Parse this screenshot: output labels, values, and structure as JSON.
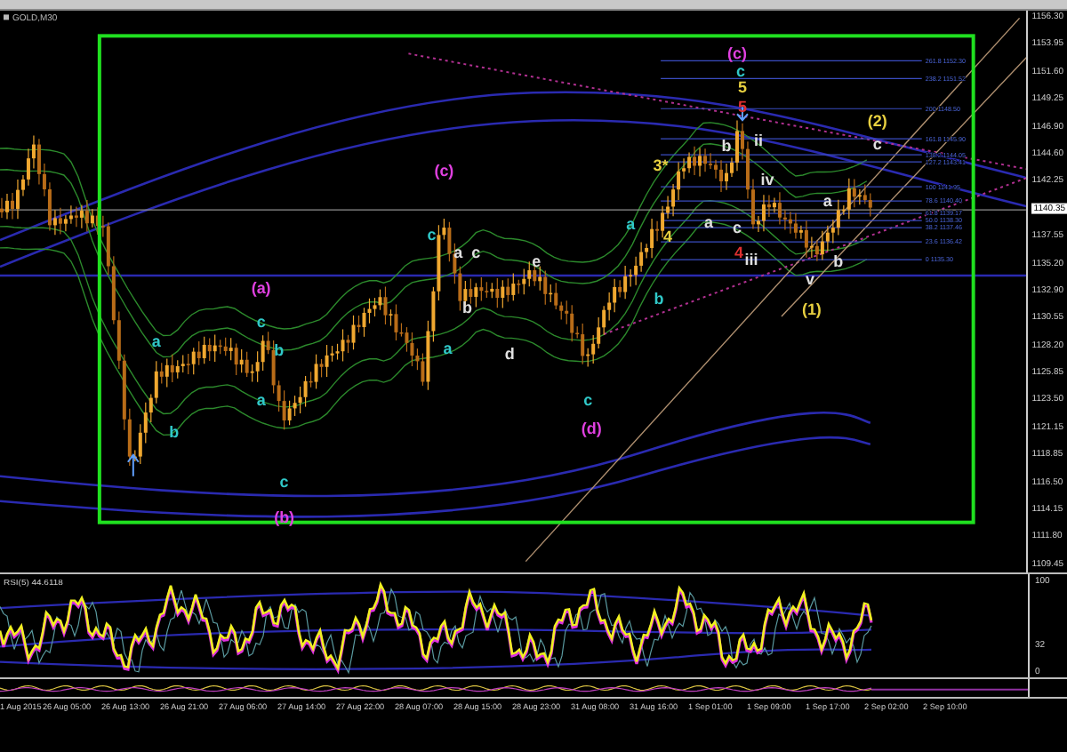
{
  "chart": {
    "symbol": "GOLD,M30",
    "price_axis": [
      {
        "text": "1156.30",
        "kind": "tick"
      },
      {
        "text": "1153.95",
        "kind": "tick"
      },
      {
        "text": "1151.60",
        "kind": "tick"
      },
      {
        "text": "1149.25",
        "kind": "tick"
      },
      {
        "text": "1146.90",
        "kind": "tick"
      },
      {
        "text": "1144.60",
        "kind": "tick"
      },
      {
        "text": "1142.25",
        "kind": "tick"
      },
      {
        "text": "1140.35",
        "kind": "current"
      },
      {
        "text": "1137.55",
        "kind": "tick"
      },
      {
        "text": "1135.20",
        "kind": "tick"
      },
      {
        "text": "1132.90",
        "kind": "tick"
      },
      {
        "text": "1130.55",
        "kind": "tick"
      },
      {
        "text": "1128.20",
        "kind": "tick"
      },
      {
        "text": "1125.85",
        "kind": "tick"
      },
      {
        "text": "1123.50",
        "kind": "tick"
      },
      {
        "text": "1121.15",
        "kind": "tick"
      },
      {
        "text": "1118.85",
        "kind": "tick"
      },
      {
        "text": "1116.50",
        "kind": "tick"
      },
      {
        "text": "1114.15",
        "kind": "tick"
      },
      {
        "text": "1111.80",
        "kind": "tick"
      },
      {
        "text": "1109.45",
        "kind": "tick"
      }
    ],
    "fib_levels": [
      "261.8 1152.30",
      "238.2 1151.52",
      "200 1148.50",
      "161.8 1145.90",
      "138.2 1144.05",
      "127.2 1143.41",
      "100 1141.95",
      "78.6 1140.40",
      "61.8 1139.17",
      "50.0 1138.30",
      "38.2 1137.46",
      "23.6 1136.42",
      "0 1135.30"
    ],
    "wave_labels": [
      {
        "text": "(a)",
        "color": "#e040e0"
      },
      {
        "text": "a",
        "color": "#30c8c8"
      },
      {
        "text": "b",
        "color": "#30c8c8"
      },
      {
        "text": "c",
        "color": "#30c8c8"
      },
      {
        "text": "b",
        "color": "#30c8c8"
      },
      {
        "text": "a",
        "color": "#30c8c8"
      },
      {
        "text": "c",
        "color": "#30c8c8"
      },
      {
        "text": "(b)",
        "color": "#e040e0"
      },
      {
        "text": "(c)",
        "color": "#e040e0"
      },
      {
        "text": "c",
        "color": "#30c8c8"
      },
      {
        "text": "a",
        "color": "#e0e0e0"
      },
      {
        "text": "c",
        "color": "#e0e0e0"
      },
      {
        "text": "e",
        "color": "#e0e0e0"
      },
      {
        "text": "b",
        "color": "#e0e0e0"
      },
      {
        "text": "a",
        "color": "#30c8c8"
      },
      {
        "text": "d",
        "color": "#e0e0e0"
      },
      {
        "text": "c",
        "color": "#30c8c8"
      },
      {
        "text": "(d)",
        "color": "#e040e0"
      },
      {
        "text": "a",
        "color": "#30c8c8"
      },
      {
        "text": "4",
        "color": "#e8d040"
      },
      {
        "text": "b",
        "color": "#30c8c8"
      },
      {
        "text": "3*",
        "color": "#e8d040"
      },
      {
        "text": "(c)",
        "color": "#e040e0"
      },
      {
        "text": "c",
        "color": "#30c8c8"
      },
      {
        "text": "5",
        "color": "#e8d040"
      },
      {
        "text": "5",
        "color": "#e03030"
      },
      {
        "text": "ii",
        "color": "#e0e0e0"
      },
      {
        "text": "b",
        "color": "#e0e0e0"
      },
      {
        "text": "iv",
        "color": "#e0e0e0"
      },
      {
        "text": "a",
        "color": "#e0e0e0"
      },
      {
        "text": "c",
        "color": "#e0e0e0"
      },
      {
        "text": "4",
        "color": "#e03030"
      },
      {
        "text": "iii",
        "color": "#e0e0e0"
      },
      {
        "text": "a",
        "color": "#e0e0e0"
      },
      {
        "text": "b",
        "color": "#e0e0e0"
      },
      {
        "text": "v",
        "color": "#e0e0e0"
      },
      {
        "text": "(2)",
        "color": "#e8d040"
      },
      {
        "text": "c",
        "color": "#e0e0e0"
      },
      {
        "text": "(1)",
        "color": "#e8d040"
      }
    ]
  },
  "rsi": {
    "title": "RSI(5) 44.6118",
    "axis": [
      "100",
      "32",
      "0"
    ]
  },
  "time_axis": [
    "1 Aug 2015",
    "26 Aug 05:00",
    "26 Aug 13:00",
    "26 Aug 21:00",
    "27 Aug 06:00",
    "27 Aug 14:00",
    "27 Aug 22:00",
    "28 Aug 07:00",
    "28 Aug 15:00",
    "28 Aug 23:00",
    "31 Aug 08:00",
    "31 Aug 16:00",
    "1 Sep 01:00",
    "1 Sep 09:00",
    "1 Sep 17:00",
    "2 Sep 02:00",
    "2 Sep 10:00"
  ]
}
